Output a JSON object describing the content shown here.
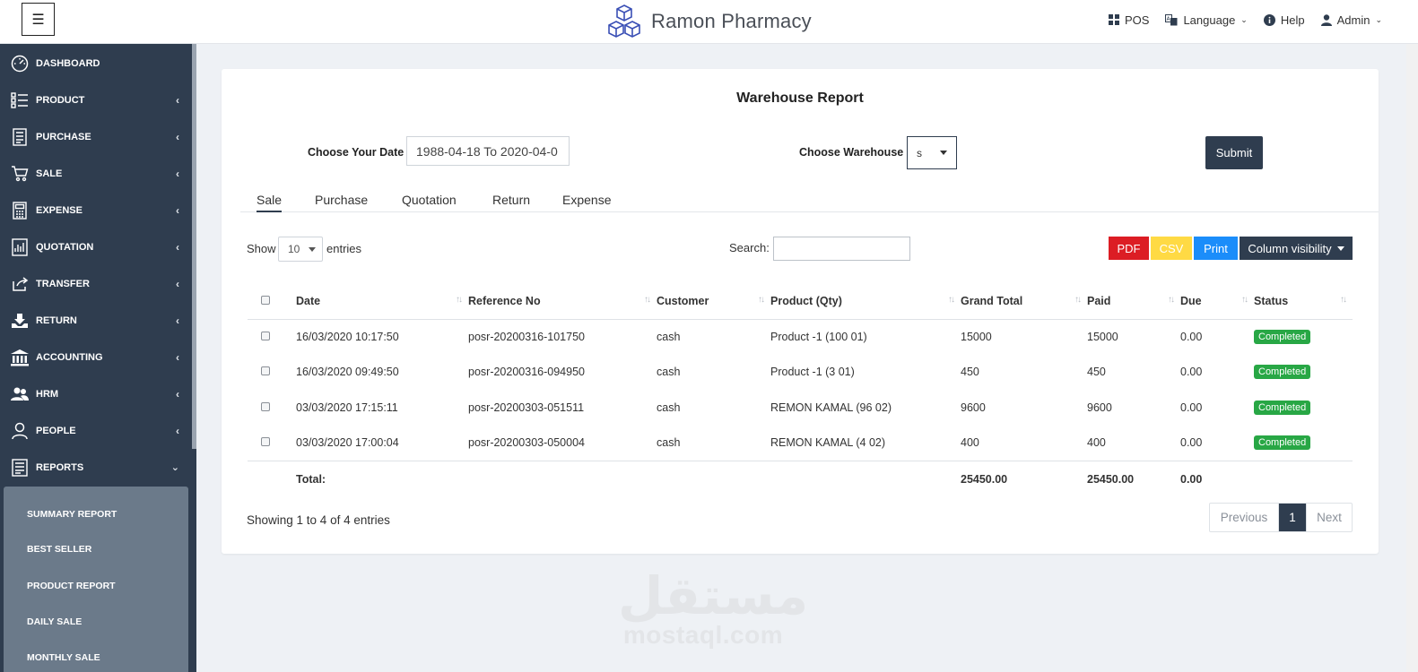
{
  "header": {
    "brand": "Ramon Pharmacy",
    "pos_label": "POS",
    "language_label": "Language",
    "help_label": "Help",
    "user_label": "Admin"
  },
  "sidebar": {
    "items": [
      {
        "label": "DASHBOARD",
        "icon": "dashboard-icon"
      },
      {
        "label": "PRODUCT",
        "icon": "product-list-icon"
      },
      {
        "label": "PURCHASE",
        "icon": "receipt-icon"
      },
      {
        "label": "SALE",
        "icon": "cart-icon"
      },
      {
        "label": "EXPENSE",
        "icon": "calculator-icon"
      },
      {
        "label": "QUOTATION",
        "icon": "quotation-icon"
      },
      {
        "label": "TRANSFER",
        "icon": "share-icon"
      },
      {
        "label": "RETURN",
        "icon": "download-icon"
      },
      {
        "label": "ACCOUNTING",
        "icon": "bank-icon"
      },
      {
        "label": "HRM",
        "icon": "users-icon"
      },
      {
        "label": "PEOPLE",
        "icon": "user-icon"
      },
      {
        "label": "REPORTS",
        "icon": "report-icon"
      }
    ],
    "sub_items": [
      "SUMMARY REPORT",
      "BEST SELLER",
      "PRODUCT REPORT",
      "DAILY SALE",
      "MONTHLY SALE"
    ]
  },
  "report": {
    "title": "Warehouse Report",
    "date_label": "Choose Your Date",
    "date_value": "1988-04-18 To 2020-04-0",
    "warehouse_label": "Choose Warehouse",
    "warehouse_value": "s",
    "submit_label": "Submit",
    "tabs": [
      "Sale",
      "Purchase",
      "Quotation",
      "Return",
      "Expense"
    ],
    "show_label": "Show",
    "entries_value": "10",
    "entries_label": "entries",
    "search_label": "Search:",
    "search_value": "",
    "buttons": {
      "pdf": "PDF",
      "csv": "CSV",
      "print": "Print",
      "colvis": "Column visibility"
    },
    "columns": [
      "Date",
      "Reference No",
      "Customer",
      "Product (Qty)",
      "Grand Total",
      "Paid",
      "Due",
      "Status"
    ],
    "rows": [
      {
        "date": "16/03/2020 10:17:50",
        "ref": "posr-20200316-101750",
        "customer": "cash",
        "product": "Product -1 (100 01)",
        "grand_total": "15000",
        "paid": "15000",
        "due": "0.00",
        "status": "Completed"
      },
      {
        "date": "16/03/2020 09:49:50",
        "ref": "posr-20200316-094950",
        "customer": "cash",
        "product": "Product -1 (3 01)",
        "grand_total": "450",
        "paid": "450",
        "due": "0.00",
        "status": "Completed"
      },
      {
        "date": "03/03/2020 17:15:11",
        "ref": "posr-20200303-051511",
        "customer": "cash",
        "product": "REMON KAMAL (96 02)",
        "grand_total": "9600",
        "paid": "9600",
        "due": "0.00",
        "status": "Completed"
      },
      {
        "date": "03/03/2020 17:00:04",
        "ref": "posr-20200303-050004",
        "customer": "cash",
        "product": "REMON KAMAL (4 02)",
        "grand_total": "400",
        "paid": "400",
        "due": "0.00",
        "status": "Completed"
      }
    ],
    "footer": {
      "label": "Total:",
      "grand_total": "25450.00",
      "paid": "25450.00",
      "due": "0.00"
    },
    "info": "Showing 1 to 4 of 4 entries",
    "pagination": {
      "previous": "Previous",
      "current": "1",
      "next": "Next"
    }
  },
  "watermark": {
    "arabic": "مستقل",
    "english": "mostaql.com"
  },
  "colors": {
    "sidebar": "#2f3d4f",
    "submenu": "#6b7a8a",
    "pdf": "#dc1d24",
    "csv": "#ffda44",
    "print": "#1b8dfa",
    "badge": "#28a745"
  }
}
